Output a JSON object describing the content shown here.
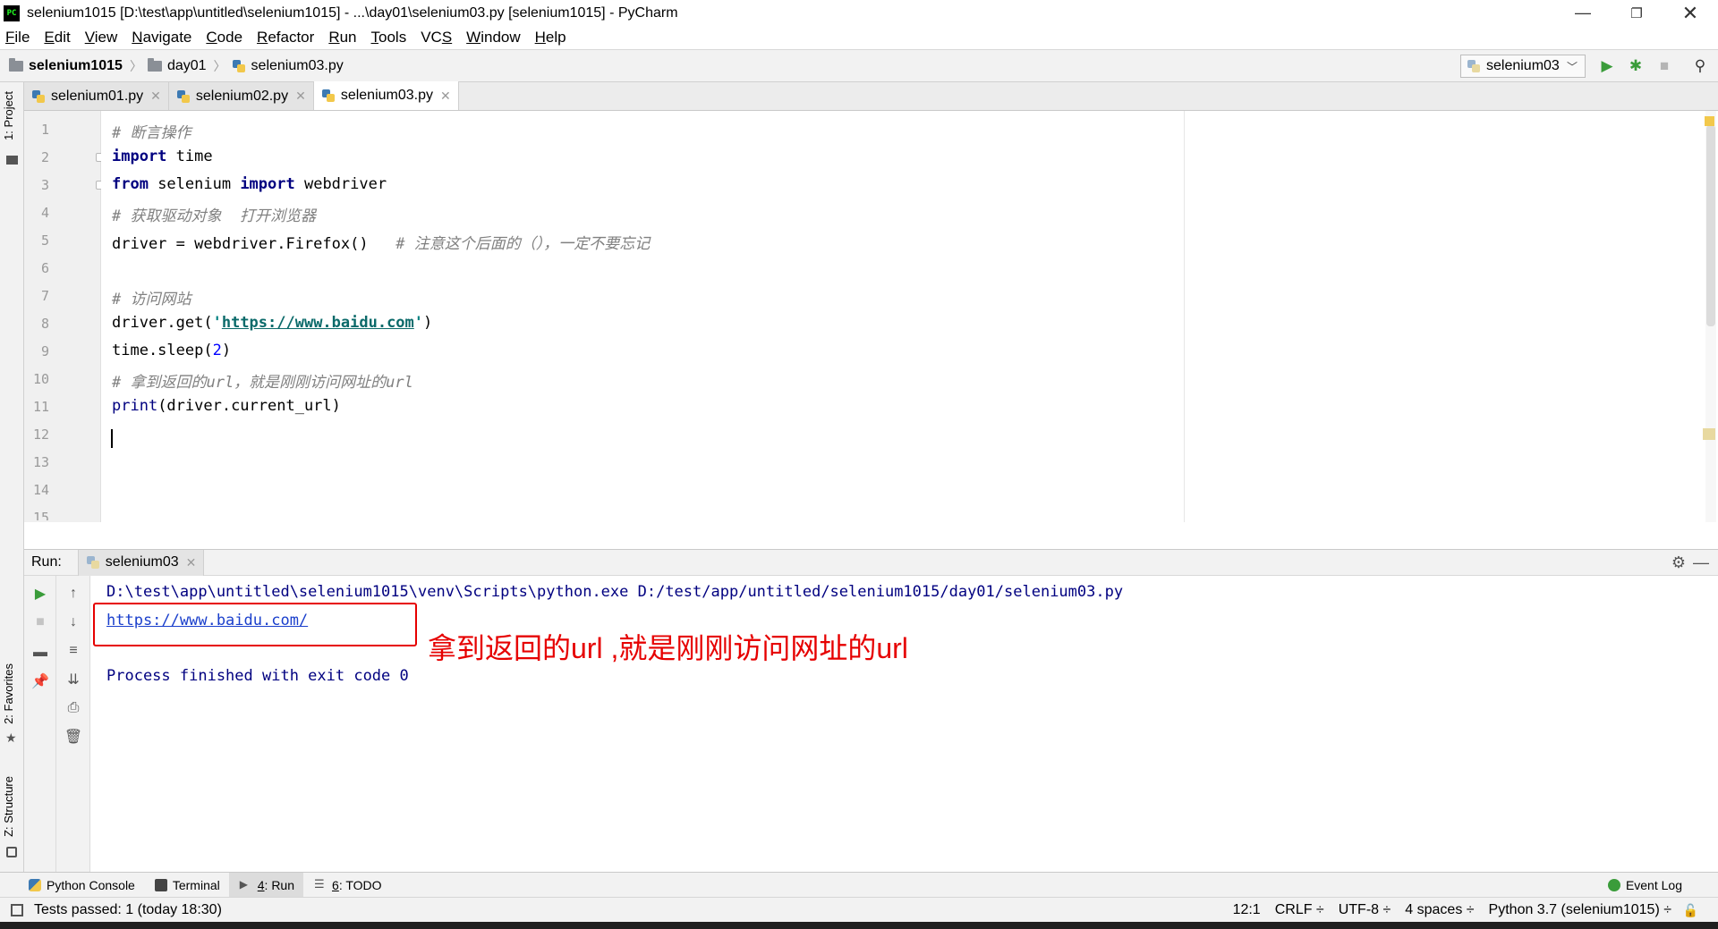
{
  "window": {
    "app_icon": "PC",
    "title": "selenium1015 [D:\\test\\app\\untitled\\selenium1015] - ...\\day01\\selenium03.py [selenium1015] - PyCharm",
    "controls": [
      "minimize-icon",
      "restore-icon",
      "close-icon"
    ]
  },
  "menu": [
    {
      "u": "F",
      "rest": "ile"
    },
    {
      "u": "E",
      "rest": "dit"
    },
    {
      "u": "V",
      "rest": "iew"
    },
    {
      "u": "N",
      "rest": "avigate"
    },
    {
      "u": "C",
      "rest": "ode"
    },
    {
      "u": "R",
      "rest": "efactor"
    },
    {
      "u": "R",
      "rest": "un",
      "pre": ""
    },
    {
      "u": "T",
      "rest": "ools"
    },
    {
      "pre": "VC",
      "u": "S",
      "rest": ""
    },
    {
      "u": "W",
      "rest": "indow"
    },
    {
      "u": "H",
      "rest": "elp"
    }
  ],
  "breadcrumb": {
    "project": "selenium1015",
    "folder": "day01",
    "file": "selenium03.py"
  },
  "toolbar": {
    "run_config": "selenium03"
  },
  "left_strip": {
    "project": "1: Project",
    "favorites": "2: Favorites",
    "structure": "Z: Structure"
  },
  "tabs": [
    {
      "label": "selenium01.py",
      "active": false
    },
    {
      "label": "selenium02.py",
      "active": false
    },
    {
      "label": "selenium03.py",
      "active": true
    }
  ],
  "editor": {
    "line_numbers": [
      "1",
      "2",
      "3",
      "4",
      "5",
      "6",
      "7",
      "8",
      "9",
      "10",
      "11",
      "12",
      "13",
      "14",
      "15"
    ],
    "line1_comment": "# 断言操作",
    "line2_kw": "import",
    "line2_rest": " time",
    "line3_kw1": "from",
    "line3_mid": " selenium ",
    "line3_kw2": "import",
    "line3_rest": " webdriver",
    "line4_comment": "# 获取驱动对象  打开浏览器",
    "line5_code": "driver = webdriver.Firefox()   ",
    "line5_comment": "# 注意这个后面的（），一定不要忘记",
    "line7_comment": "# 访问网站",
    "line8_pre": "driver.get(",
    "line8_q1": "'",
    "line8_url": "https://www.baidu.com",
    "line8_q2": "'",
    "line8_post": ")",
    "line9_pre": "time.sleep(",
    "line9_num": "2",
    "line9_post": ")",
    "line10_comment": "# 拿到返回的url，就是刚刚访问网址的url",
    "line11_fn": "print",
    "line11_rest": "(driver.current_url)",
    "current_line": 12
  },
  "run_panel": {
    "label": "Run:",
    "tab": "selenium03",
    "console": {
      "command": "D:\\test\\app\\untitled\\selenium1015\\venv\\Scripts\\python.exe D:/test/app/untitled/selenium1015/day01/selenium03.py",
      "output_url": "https://www.baidu.com/",
      "exit": "Process finished with exit code 0"
    },
    "annotation": "拿到返回的url ,就是刚刚访问网址的url",
    "annotation_color": "#e60000"
  },
  "bottom_tabs": [
    {
      "label": "Python Console",
      "icon": "python-console-icon"
    },
    {
      "label": "Terminal",
      "icon": "terminal-icon"
    },
    {
      "num": "4",
      "label": ": Run",
      "icon": "run-icon",
      "active": true
    },
    {
      "num": "6",
      "label": ": TODO",
      "icon": "todo-icon"
    }
  ],
  "event_log": "Event Log",
  "status": {
    "left": "Tests passed: 1 (today 18:30)",
    "position": "12:1",
    "line_sep": "CRLF ÷",
    "encoding": "UTF-8 ÷",
    "indent": "4 spaces ÷",
    "interpreter": "Python 3.7 (selenium1015) ÷"
  },
  "colors": {
    "keyword": "#000080",
    "comment": "#808080",
    "current_line": "#fffae3",
    "accent_green": "#3a9c3a"
  }
}
